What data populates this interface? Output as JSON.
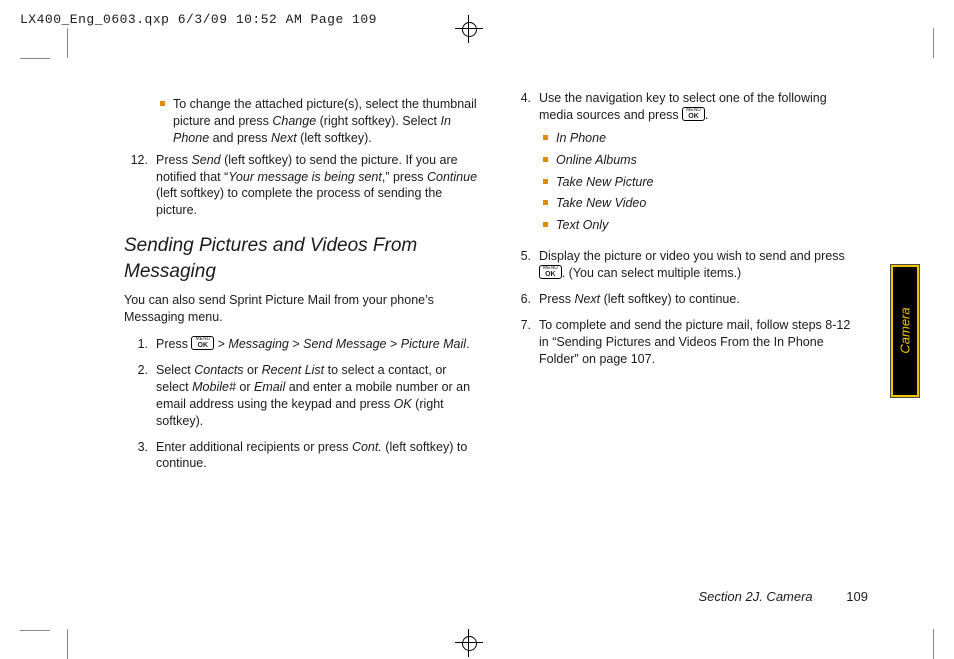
{
  "header": "LX400_Eng_0603.qxp  6/3/09  10:52 AM  Page 109",
  "tab": "Camera",
  "footer_section": "Section 2J. Camera",
  "footer_page": "109",
  "ok_top": "MENU",
  "ok_bot": "OK",
  "left": {
    "bullet1a": "To change the attached picture(s), select the thumbnail picture and press ",
    "bullet1b": "Change",
    "bullet1c": " (right softkey). Select ",
    "bullet1d": "In Phone",
    "bullet1e": " and press ",
    "bullet1f": "Next",
    "bullet1g": " (left softkey).",
    "step12n": "12.",
    "step12a": "Press ",
    "step12b": "Send",
    "step12c": " (left softkey) to send the picture. If you are notified that “",
    "step12d": "Your message is being sent",
    "step12e": ",” press ",
    "step12f": "Continue",
    "step12g": " (left softkey) to complete the process of sending the picture.",
    "heading": "Sending Pictures and Videos From Messaging",
    "intro": "You can also send Sprint Picture Mail from your phone’s Messaging menu.",
    "s1n": "1.",
    "s1a": "Press ",
    "s1b": " > ",
    "s1c": "Messaging",
    "s1d": " > ",
    "s1e": "Send Message",
    "s1f": " > ",
    "s1g": "Picture Mail",
    "s1h": ".",
    "s2n": "2.",
    "s2a": "Select ",
    "s2b": "Contacts",
    "s2c": " or ",
    "s2d": "Recent List",
    "s2e": " to select a contact, or select ",
    "s2f": "Mobile#",
    "s2g": " or ",
    "s2h": "Email",
    "s2i": " and enter a mobile number or an email address using the keypad and press ",
    "s2j": "OK",
    "s2k": " (right softkey).",
    "s3n": "3.",
    "s3a": "Enter additional recipients or press ",
    "s3b": "Cont.",
    "s3c": " (left softkey) to continue."
  },
  "right": {
    "s4n": "4.",
    "s4a": "Use the navigation key to select one of the following media sources and press ",
    "s4b": ".",
    "b1": "In Phone",
    "b2": "Online Albums",
    "b3": "Take New Picture",
    "b4": "Take New Video",
    "b5": "Text Only",
    "s5n": "5.",
    "s5a": "Display the picture or video you wish to send and press ",
    "s5b": ". (You can select multiple items.)",
    "s6n": "6.",
    "s6a": " Press ",
    "s6b": "Next",
    "s6c": " (left softkey) to continue.",
    "s7n": "7.",
    "s7a": " To complete and send the picture mail, follow steps 8-12 in “Sending Pictures and Videos From the In Phone Folder” on page 107."
  }
}
